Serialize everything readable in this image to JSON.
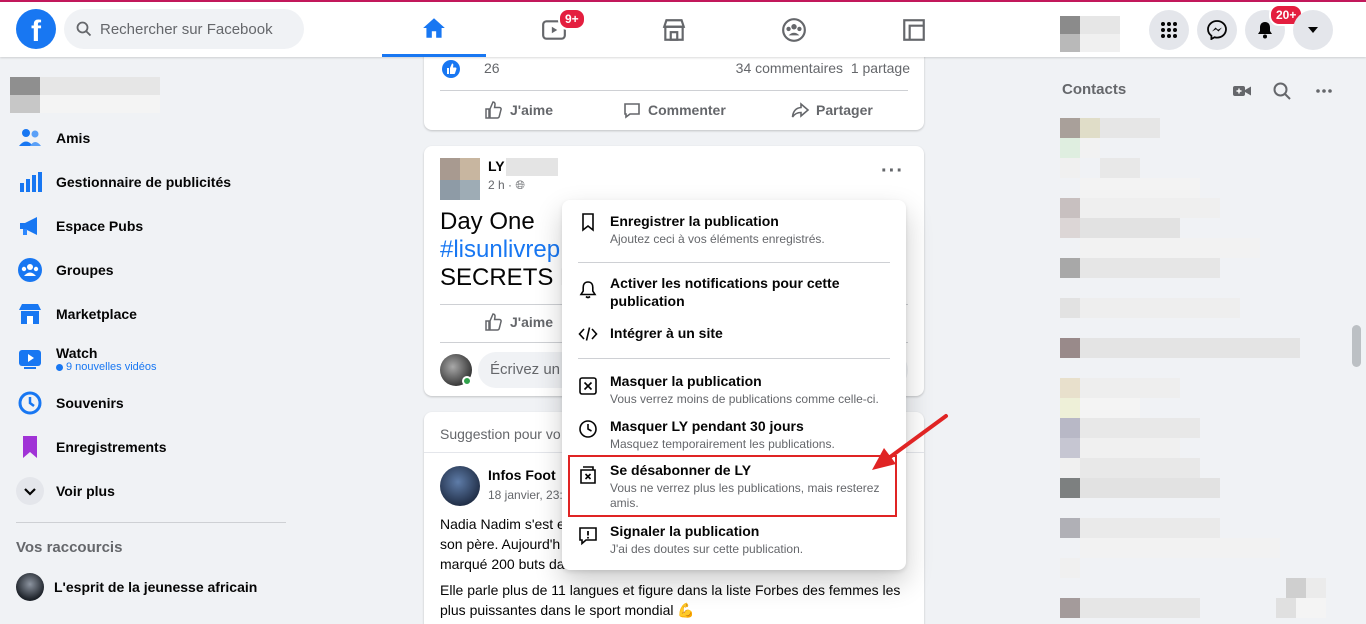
{
  "topbar": {
    "search_placeholder": "Rechercher sur Facebook",
    "logo_letter": "f",
    "video_badge": "9+",
    "notifications_badge": "20+"
  },
  "sidebar": {
    "items": [
      {
        "label": "Amis"
      },
      {
        "label": "Gestionnaire de publicités"
      },
      {
        "label": "Espace Pubs"
      },
      {
        "label": "Groupes"
      },
      {
        "label": "Marketplace"
      },
      {
        "label": "Watch",
        "sub": "9 nouvelles vidéos"
      },
      {
        "label": "Souvenirs"
      },
      {
        "label": "Enregistrements"
      },
      {
        "label": "Voir plus"
      }
    ],
    "shortcuts_title": "Vos raccourcis",
    "shortcut_1": "L'esprit de la jeunesse africain"
  },
  "feed": {
    "post1": {
      "like_count": "26",
      "comments": "34 commentaires",
      "shares": "1 partage",
      "like_label": "J'aime",
      "comment_label": "Commenter",
      "share_label": "Partager"
    },
    "post2": {
      "author": "LY",
      "time": "2 h ·",
      "line1": "Day One",
      "line2": "#lisunlivrep",
      "line3": "SECRETS DE",
      "like_label": "J'aime",
      "comment_placeholder": "Écrivez un c"
    },
    "post3": {
      "suggestion": "Suggestion pour vo",
      "author": "Infos Foot",
      "date": "18 janvier, 23:",
      "text1_l1": "Nadia Nadim s'est e",
      "text1_l2": "son père. Aujourd'h",
      "text1_l3": "marqué 200 buts da",
      "text2": "Elle parle plus de 11 langues et figure dans la liste Forbes des femmes les plus puissantes dans le sport mondial 💪"
    }
  },
  "menu": {
    "save_title": "Enregistrer la publication",
    "save_desc": "Ajoutez ceci à vos éléments enregistrés.",
    "notif_title": "Activer les notifications pour cette publication",
    "embed_title": "Intégrer à un site",
    "hide_title": "Masquer la publication",
    "hide_desc": "Vous verrez moins de publications comme celle-ci.",
    "snooze_title": "Masquer LY pendant 30 jours",
    "snooze_desc": "Masquez temporairement les publications.",
    "unfollow_title": "Se désabonner de LY",
    "unfollow_desc": "Vous ne verrez plus les publications, mais resterez amis.",
    "report_title": "Signaler la publication",
    "report_desc": "J'ai des doutes sur cette publication."
  },
  "contacts": {
    "title": "Contacts"
  },
  "colors": {
    "accent": "#1877f2",
    "highlight": "#e02424"
  }
}
